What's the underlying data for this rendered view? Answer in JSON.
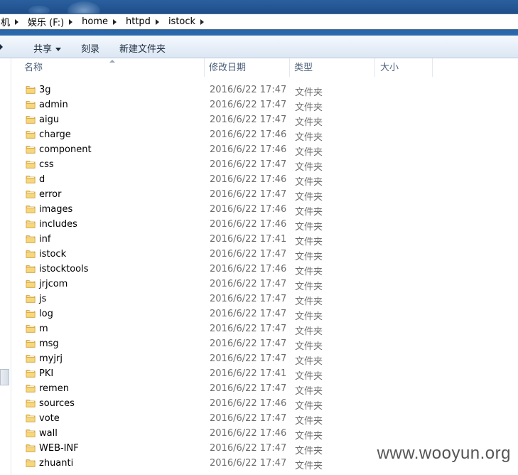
{
  "breadcrumb": {
    "items": [
      "机",
      "娱乐 (F:)",
      "home",
      "httpd",
      "istock"
    ]
  },
  "toolbar": {
    "share_label": "共享",
    "burn_label": "刻录",
    "new_folder_label": "新建文件夹"
  },
  "columns": {
    "name": "名称",
    "date": "修改日期",
    "type": "类型",
    "size": "大小"
  },
  "files": [
    {
      "name": "3g",
      "date": "2016/6/22 17:47",
      "type": "文件夹"
    },
    {
      "name": "admin",
      "date": "2016/6/22 17:47",
      "type": "文件夹"
    },
    {
      "name": "aigu",
      "date": "2016/6/22 17:47",
      "type": "文件夹"
    },
    {
      "name": "charge",
      "date": "2016/6/22 17:46",
      "type": "文件夹"
    },
    {
      "name": "component",
      "date": "2016/6/22 17:46",
      "type": "文件夹"
    },
    {
      "name": "css",
      "date": "2016/6/22 17:47",
      "type": "文件夹"
    },
    {
      "name": "d",
      "date": "2016/6/22 17:46",
      "type": "文件夹"
    },
    {
      "name": "error",
      "date": "2016/6/22 17:47",
      "type": "文件夹"
    },
    {
      "name": "images",
      "date": "2016/6/22 17:46",
      "type": "文件夹"
    },
    {
      "name": "includes",
      "date": "2016/6/22 17:46",
      "type": "文件夹"
    },
    {
      "name": "inf",
      "date": "2016/6/22 17:41",
      "type": "文件夹"
    },
    {
      "name": "istock",
      "date": "2016/6/22 17:47",
      "type": "文件夹"
    },
    {
      "name": "istocktools",
      "date": "2016/6/22 17:46",
      "type": "文件夹"
    },
    {
      "name": "jrjcom",
      "date": "2016/6/22 17:47",
      "type": "文件夹"
    },
    {
      "name": "js",
      "date": "2016/6/22 17:47",
      "type": "文件夹"
    },
    {
      "name": "log",
      "date": "2016/6/22 17:47",
      "type": "文件夹"
    },
    {
      "name": "m",
      "date": "2016/6/22 17:47",
      "type": "文件夹"
    },
    {
      "name": "msg",
      "date": "2016/6/22 17:47",
      "type": "文件夹"
    },
    {
      "name": "myjrj",
      "date": "2016/6/22 17:47",
      "type": "文件夹"
    },
    {
      "name": "PKI",
      "date": "2016/6/22 17:41",
      "type": "文件夹"
    },
    {
      "name": "remen",
      "date": "2016/6/22 17:47",
      "type": "文件夹"
    },
    {
      "name": "sources",
      "date": "2016/6/22 17:46",
      "type": "文件夹"
    },
    {
      "name": "vote",
      "date": "2016/6/22 17:47",
      "type": "文件夹"
    },
    {
      "name": "wall",
      "date": "2016/6/22 17:46",
      "type": "文件夹"
    },
    {
      "name": "WEB-INF",
      "date": "2016/6/22 17:47",
      "type": "文件夹"
    },
    {
      "name": "zhuanti",
      "date": "2016/6/22 17:47",
      "type": "文件夹"
    }
  ],
  "icons": {
    "folder": "folder-icon",
    "breadcrumb_separator": "chevron-right-icon",
    "dropdown": "chevron-down-icon",
    "sort": "sort-ascending-icon"
  },
  "colors": {
    "folder_fill": "#f1c65a",
    "folder_edge": "#c9962a",
    "header_text": "#4c607a",
    "meta_text": "#6d6d6d"
  },
  "watermark": "www.wooyun.org"
}
